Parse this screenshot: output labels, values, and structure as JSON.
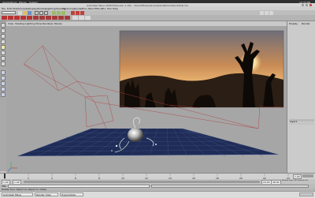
{
  "system_bar": {
    "applications": "Applications",
    "places": "Places",
    "system": "System",
    "clock": "12:33 PM"
  },
  "window": {
    "title": "Autodesk Maya 2008 Extension 2 x64 - /home/ftp/asg/scenes/bullet/solidworkfinal.ma"
  },
  "menu": {
    "items": [
      "File",
      "Edit",
      "Modify",
      "Create",
      "Display",
      "Window",
      "Lighting/Shading",
      "Texturing",
      "Render",
      "Toon",
      "Paint Effects",
      "Fur",
      "Hair",
      "Help"
    ]
  },
  "toolbar": {
    "mode": "Rendering"
  },
  "panel_menu": {
    "items": [
      "View",
      "Shading",
      "Lighting",
      "Show",
      "Renderer",
      "Panels"
    ]
  },
  "viewport": {
    "colors": {
      "background": "#a6a6a6",
      "grid": "#1e2c57",
      "grid_lines": "#4a5c8c",
      "wire": "#b23b3b",
      "camera_lines": "#7a6f6f",
      "sky": "#f4c27a",
      "sun": "#fff2b0"
    },
    "icons": [
      "camera-frustum",
      "image-plane",
      "ground-grid",
      "chrome-sphere-object",
      "perspective-axis"
    ]
  },
  "channel_box": {
    "tab": "Display",
    "tab2": "Render",
    "layer_label": "layer1"
  },
  "time_slider": {
    "ticks": [
      "1",
      "2",
      "4",
      "6",
      "8",
      "10",
      "12",
      "14",
      "16",
      "18",
      "20",
      "22",
      "24"
    ],
    "current_frame": "1.00"
  },
  "range_slider": {
    "start": "1.00",
    "start_inner": "1.00",
    "end_inner": "24.00",
    "end": "48.00",
    "anim_layer": "No Anim Layer",
    "character": "No Character Set"
  },
  "command_line": {
    "label": "MEL"
  },
  "help_line": {
    "text": "Rotate Tool: Select an object to rotate."
  },
  "taskbar": {
    "items": [
      "Autodesk Maya",
      "Render View",
      "Hypershade"
    ]
  }
}
